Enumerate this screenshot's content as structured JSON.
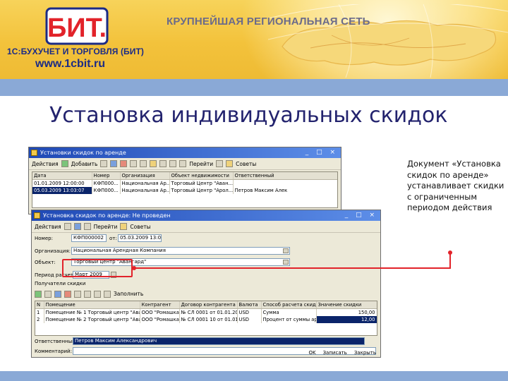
{
  "header": {
    "slogan": "КРУПНЕЙШАЯ РЕГИОНАЛЬНАЯ СЕТЬ",
    "brand": "1С:БУХУЧЕТ И ТОРГОВЛЯ (БИТ)",
    "url": "www.1cbit.ru",
    "logo_text": "БИТ."
  },
  "slide_title": "Установка индивидуальных скидок",
  "description": "Документ «Установка скидок по аренде» устанавливает скидки с ограниченным периодом действия",
  "list_window": {
    "title": "Установки скидок по аренде",
    "buttons": {
      "actions": "Действия",
      "add": "Добавить",
      "goto": "Перейти",
      "help": "Советы"
    },
    "columns": [
      "Дата",
      "Номер",
      "Организация",
      "Объект недвижимости",
      "Ответственный"
    ],
    "rows": [
      [
        "01.01.2009 12:00:00",
        "КФП000...",
        "Национальная Ар...",
        "Торговый Центр \"Аван...",
        ""
      ],
      [
        "05.03.2009 13:03:07",
        "КФП000...",
        "Национальная Ар...",
        "Торговый Центр \"Арол...",
        "Петров Максим Алек"
      ]
    ]
  },
  "doc_window": {
    "title": "Установка скидок по аренде: Не проведен",
    "buttons": {
      "actions": "Действия",
      "goto": "Перейти",
      "help": "Советы",
      "fill": "Заполнить"
    },
    "fields": {
      "number_label": "Номер:",
      "number": "КФП000002",
      "from": "от:",
      "date": "05.03.2009 13:03:07",
      "org_label": "Организация:",
      "org": "Национальная Арендная Компания",
      "obj_label": "Объект:",
      "obj": "Торговый центр \"Авангард\"",
      "period_label": "Период расчета:",
      "period": "Март 2009",
      "recipients_label": "Получатели скидки",
      "resp_label": "Ответственный:",
      "resp": "Петров Максим Александрович",
      "comment_label": "Комментарий:"
    },
    "columns": [
      "N",
      "Помещение",
      "Контрагент",
      "Договор контрагента",
      "Валюта",
      "Способ расчета скидки ...",
      "Значение скидки"
    ],
    "rows": [
      [
        "1",
        "Помещение № 1 Торговый центр \"Авангард\"",
        "ООО \"Ромашка\"",
        "№ СЛ 0001 от 01.01.20...",
        "USD",
        "Сумма",
        "150,00"
      ],
      [
        "2",
        "Помещение № 2 Торговый центр \"Авангард\"",
        "ООО \"Ромашка\"",
        "№ СЛ 0001 10 от 01.01.20...",
        "USD",
        "Процент от суммы аренды",
        "12,00"
      ]
    ],
    "footer": {
      "ok": "OK",
      "save": "Записать",
      "close": "Закрыть"
    }
  },
  "colors": {
    "banner": "#f3c23b",
    "bluebar": "#8aa9d6",
    "title": "#23236e",
    "highlight": "#e2232a",
    "brand": "#1b2b86"
  }
}
